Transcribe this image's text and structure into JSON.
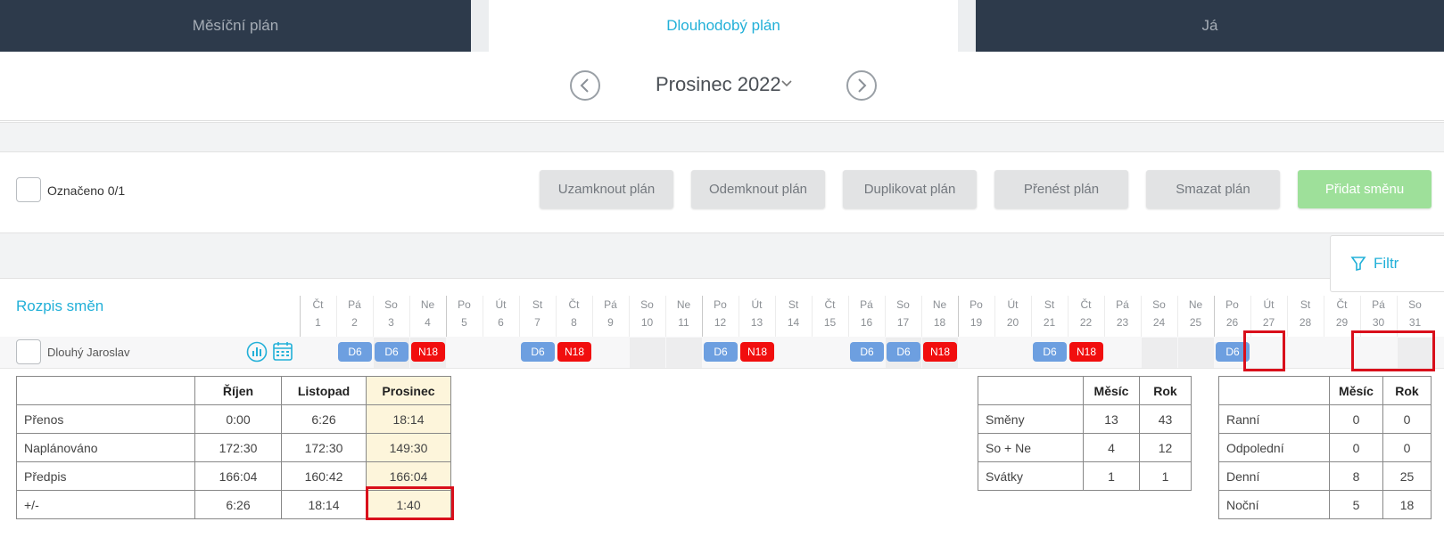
{
  "tabs": [
    {
      "label": "Měsíční plán"
    },
    {
      "label": "Dlouhodobý plán"
    },
    {
      "label": "Já"
    }
  ],
  "month": {
    "label": "Prosinec 2022"
  },
  "toolbar": {
    "selected_label": "Označeno 0/1",
    "lock": "Uzamknout plán",
    "unlock": "Odemknout plán",
    "duplicate": "Duplikovat plán",
    "transfer": "Přenést plán",
    "delete": "Smazat plán",
    "add_shift": "Přidat směnu"
  },
  "filter": {
    "label": "Filtr"
  },
  "schedule": {
    "title": "Rozpis směn",
    "employee": "Dlouhý Jaroslav",
    "days": [
      {
        "dow": "Čt",
        "d": "1"
      },
      {
        "dow": "Pá",
        "d": "2"
      },
      {
        "dow": "So",
        "d": "3"
      },
      {
        "dow": "Ne",
        "d": "4"
      },
      {
        "dow": "Po",
        "d": "5"
      },
      {
        "dow": "Út",
        "d": "6"
      },
      {
        "dow": "St",
        "d": "7"
      },
      {
        "dow": "Čt",
        "d": "8"
      },
      {
        "dow": "Pá",
        "d": "9"
      },
      {
        "dow": "So",
        "d": "10"
      },
      {
        "dow": "Ne",
        "d": "11"
      },
      {
        "dow": "Po",
        "d": "12"
      },
      {
        "dow": "Út",
        "d": "13"
      },
      {
        "dow": "St",
        "d": "14"
      },
      {
        "dow": "Čt",
        "d": "15"
      },
      {
        "dow": "Pá",
        "d": "16"
      },
      {
        "dow": "So",
        "d": "17"
      },
      {
        "dow": "Ne",
        "d": "18"
      },
      {
        "dow": "Po",
        "d": "19"
      },
      {
        "dow": "Út",
        "d": "20"
      },
      {
        "dow": "St",
        "d": "21"
      },
      {
        "dow": "Čt",
        "d": "22"
      },
      {
        "dow": "Pá",
        "d": "23"
      },
      {
        "dow": "So",
        "d": "24"
      },
      {
        "dow": "Ne",
        "d": "25"
      },
      {
        "dow": "Po",
        "d": "26"
      },
      {
        "dow": "Út",
        "d": "27"
      },
      {
        "dow": "St",
        "d": "28"
      },
      {
        "dow": "Čt",
        "d": "29"
      },
      {
        "dow": "Pá",
        "d": "30"
      },
      {
        "dow": "So",
        "d": "31"
      }
    ],
    "shifts": [
      {
        "day": 2,
        "code": "D6",
        "kind": "d"
      },
      {
        "day": 3,
        "code": "D6",
        "kind": "d"
      },
      {
        "day": 4,
        "code": "N18",
        "kind": "n"
      },
      {
        "day": 7,
        "code": "D6",
        "kind": "d"
      },
      {
        "day": 8,
        "code": "N18",
        "kind": "n"
      },
      {
        "day": 12,
        "code": "D6",
        "kind": "d"
      },
      {
        "day": 13,
        "code": "N18",
        "kind": "n"
      },
      {
        "day": 16,
        "code": "D6",
        "kind": "d"
      },
      {
        "day": 17,
        "code": "D6",
        "kind": "d"
      },
      {
        "day": 18,
        "code": "N18",
        "kind": "n"
      },
      {
        "day": 21,
        "code": "D6",
        "kind": "d"
      },
      {
        "day": 22,
        "code": "N18",
        "kind": "n"
      },
      {
        "day": 26,
        "code": "D6",
        "kind": "d"
      }
    ]
  },
  "hours_table": {
    "headers": [
      "",
      "Říjen",
      "Listopad",
      "Prosinec"
    ],
    "rows": [
      [
        "Přenos",
        "0:00",
        "6:26",
        "18:14"
      ],
      [
        "Naplánováno",
        "172:30",
        "172:30",
        "149:30"
      ],
      [
        "Předpis",
        "166:04",
        "160:42",
        "166:04"
      ],
      [
        "+/-",
        "6:26",
        "18:14",
        "1:40"
      ]
    ]
  },
  "counts_table": {
    "headers": [
      "",
      "Měsíc",
      "Rok"
    ],
    "rows": [
      [
        "Směny",
        "13",
        "43"
      ],
      [
        "So + Ne",
        "4",
        "12"
      ],
      [
        "Svátky",
        "1",
        "1"
      ]
    ]
  },
  "types_table": {
    "headers": [
      "",
      "Měsíc",
      "Rok"
    ],
    "rows": [
      [
        "Ranní",
        "0",
        "0"
      ],
      [
        "Odpolední",
        "0",
        "0"
      ],
      [
        "Denní",
        "8",
        "25"
      ],
      [
        "Noční",
        "5",
        "18"
      ]
    ]
  },
  "colors": {
    "accent": "#22b0d8",
    "day_shift": "#6d9fe0",
    "night_shift": "#f10e0e",
    "highlight_box": "#d90f1b"
  }
}
